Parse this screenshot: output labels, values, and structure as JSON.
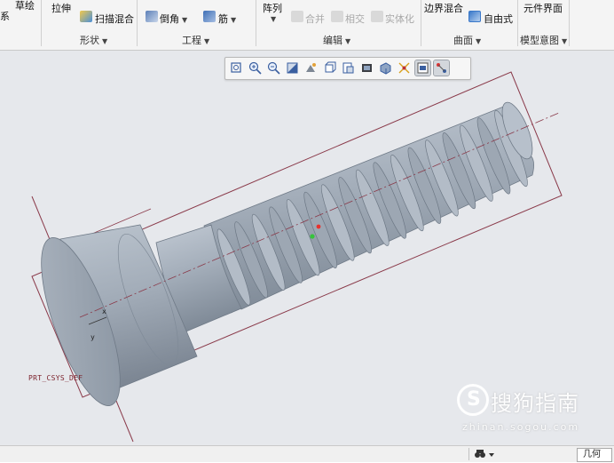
{
  "ribbon": {
    "col_a_label": "系",
    "sketch_label": "草绘",
    "extrude_label": "拉伸",
    "sweep_blend_label": "扫描混合",
    "shapes_group": "形状",
    "chamfer_label": "倒角",
    "rib_label": "筋",
    "engineering_group": "工程",
    "pattern_label": "阵列",
    "merge_label": "合并",
    "intersect_label": "相交",
    "solidify_label": "实体化",
    "editing_group": "编辑",
    "boundary_blend_label": "边界混合",
    "freestyle_label": "自由式",
    "surfaces_group": "曲面",
    "component_interface_label": "元件界面",
    "model_intent_group": "模型意图"
  },
  "graphics_toolbar": {
    "buttons": [
      "refit",
      "zoom-in",
      "zoom-out",
      "repaint",
      "named-views",
      "saved-orientations",
      "view-manager",
      "display-style",
      "perspective",
      "datum-display",
      "spin-center",
      "annotation-display"
    ]
  },
  "model": {
    "csys_label": "PRT_CSYS_DEF",
    "axis_x": "x",
    "axis_y": "y"
  },
  "watermark": {
    "logo_letter": "S",
    "title": "搜狗指南",
    "url": "zhinan.sogou.com"
  },
  "statusbar": {
    "geometry_filter": "几何"
  },
  "colors": {
    "viewport_bg": "#e6e8ec",
    "model_fill": "#a9b3bf",
    "bounding_box": "#8a3a4a",
    "csys_text": "#7a1e28",
    "ribbon_bg": "#f4f4f4"
  }
}
